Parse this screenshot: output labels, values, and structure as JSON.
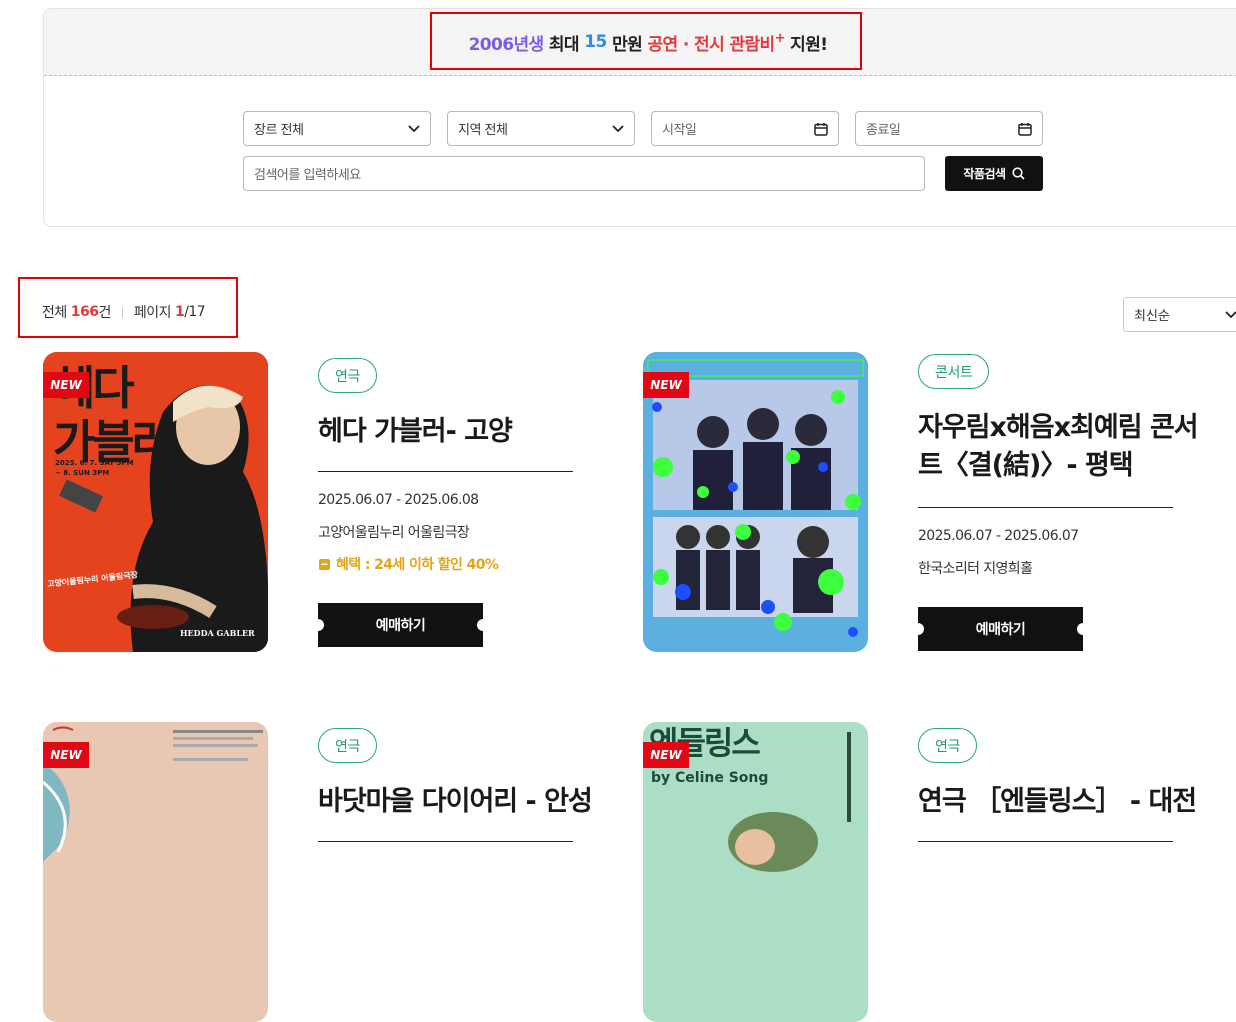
{
  "banner": {
    "part1": "2006년생",
    "part2": " 최대 ",
    "part3": "15",
    "part4": " 만원 ",
    "part5": "공연 · 전시 관람비",
    "sup": "+",
    "part6": " 지원!"
  },
  "filters": {
    "genre": "장르 전체",
    "region": "지역 전체",
    "start_date": "시작일",
    "end_date": "종료일",
    "search_placeholder": "검색어를 입력하세요",
    "search_button": "작품검색"
  },
  "summary": {
    "total_label": "전체 ",
    "total_count": "166",
    "total_unit": "건",
    "page_label": "페이지 ",
    "page_current": "1",
    "page_total": "/17"
  },
  "sort": {
    "selected": "최신순"
  },
  "colors": {
    "accent_red": "#e0393e",
    "accent_green": "#1f9a6b",
    "highlight": "#e30000"
  },
  "items": [
    {
      "badge": "NEW",
      "genre": "연극",
      "title": "헤다 가블러- 고양",
      "date": "2025.06.07 - 2025.06.08",
      "venue": "고양어울림누리 어울림극장",
      "benefit": "혜택 : 24세 이하 할인 40%",
      "button": "예매하기",
      "poster_text": {
        "title_a": "헤다",
        "title_b": "가블러",
        "dates": "2025. 6. 7. SAT 3PM\n~ 8. SUN 3PM",
        "venue": "고양어울림누리 어울림극장",
        "en": "HEDDA GABLER"
      }
    },
    {
      "badge": "NEW",
      "genre": "콘서트",
      "title": "자우림x해음x최예림 콘서트〈결(結)〉- 평택",
      "date": "2025.06.07 - 2025.06.07",
      "venue": "한국소리터 지영희홀",
      "button": "예매하기"
    },
    {
      "badge": "NEW",
      "genre": "연극",
      "title": "바닷마을 다이어리 - 안성"
    },
    {
      "badge": "NEW",
      "genre": "연극",
      "title": "연극 ［엔들링스］ - 대전",
      "poster_text": {
        "title": "엔들링스",
        "by": "by Celine Song"
      }
    }
  ]
}
